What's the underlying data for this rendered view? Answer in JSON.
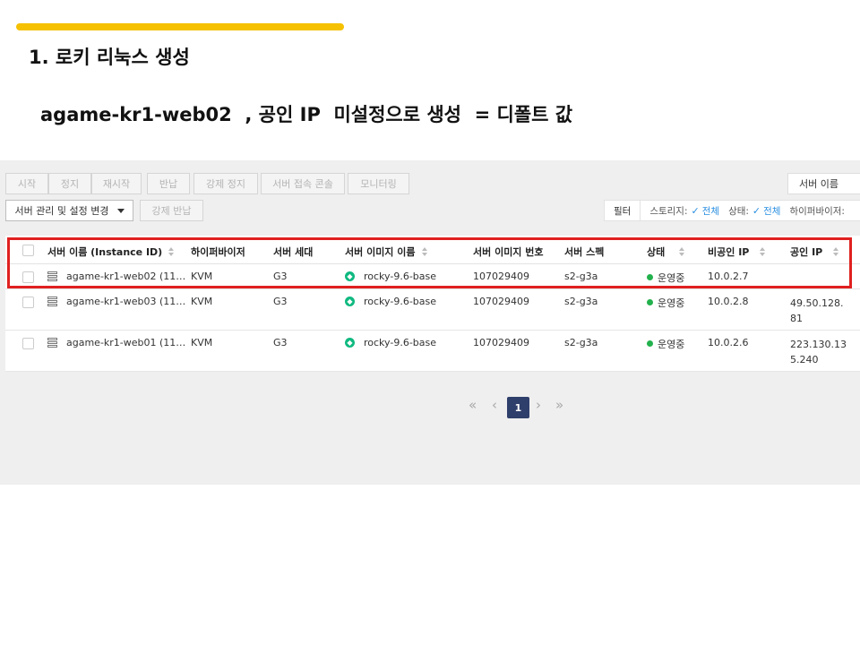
{
  "slide": {
    "title": "1. 로키 리눅스 생성",
    "subtitle": "agame-kr1-web02  , 공인 IP  미설정으로 생성  = 디폴트 값",
    "accent_color": "#f5c100"
  },
  "toolbar": {
    "start": "시작",
    "stop": "정지",
    "restart": "재시작",
    "return": "반납",
    "force_stop": "강제 정지",
    "console": "서버 접속 콘솔",
    "monitoring": "모니터링",
    "manage": "서버 관리 및 설정 변경",
    "force_return": "강제 반납",
    "search_select": "서버 이름"
  },
  "filter": {
    "button": "필터",
    "storage_label": "스토리지:",
    "storage_value": "전체",
    "state_label": "상태:",
    "state_value": "전체",
    "hypervisor_label": "하이퍼바이저:"
  },
  "table": {
    "headers": {
      "name": "서버 이름 (Instance ID)",
      "hypervisor": "하이퍼바이저",
      "generation": "서버 세대",
      "image_name": "서버 이미지 이름",
      "image_no": "서버 이미지 번호",
      "spec": "서버 스펙",
      "status": "상태",
      "private_ip": "비공인 IP",
      "public_ip": "공인 IP"
    },
    "rows": [
      {
        "name": "agame-kr1-web02 (11…",
        "hypervisor": "KVM",
        "generation": "G3",
        "image_name": "rocky-9.6-base",
        "image_no": "107029409",
        "spec": "s2-g3a",
        "status": "운영중",
        "private_ip": "10.0.2.7",
        "public_ip": ""
      },
      {
        "name": "agame-kr1-web03 (11…",
        "hypervisor": "KVM",
        "generation": "G3",
        "image_name": "rocky-9.6-base",
        "image_no": "107029409",
        "spec": "s2-g3a",
        "status": "운영중",
        "private_ip": "10.0.2.8",
        "public_ip": "49.50.128.81"
      },
      {
        "name": "agame-kr1-web01 (11…",
        "hypervisor": "KVM",
        "generation": "G3",
        "image_name": "rocky-9.6-base",
        "image_no": "107029409",
        "spec": "s2-g3a",
        "status": "운영중",
        "private_ip": "10.0.2.6",
        "public_ip": "223.130.135.240"
      }
    ],
    "status_color": "#22b14c"
  },
  "pagination": {
    "first": "«",
    "prev": "‹",
    "current": "1",
    "next": "›",
    "last": "»"
  },
  "icons": {
    "server": "server-icon",
    "os": "rocky-linux-icon",
    "check": "check-icon"
  },
  "highlight_color": "#e02020"
}
